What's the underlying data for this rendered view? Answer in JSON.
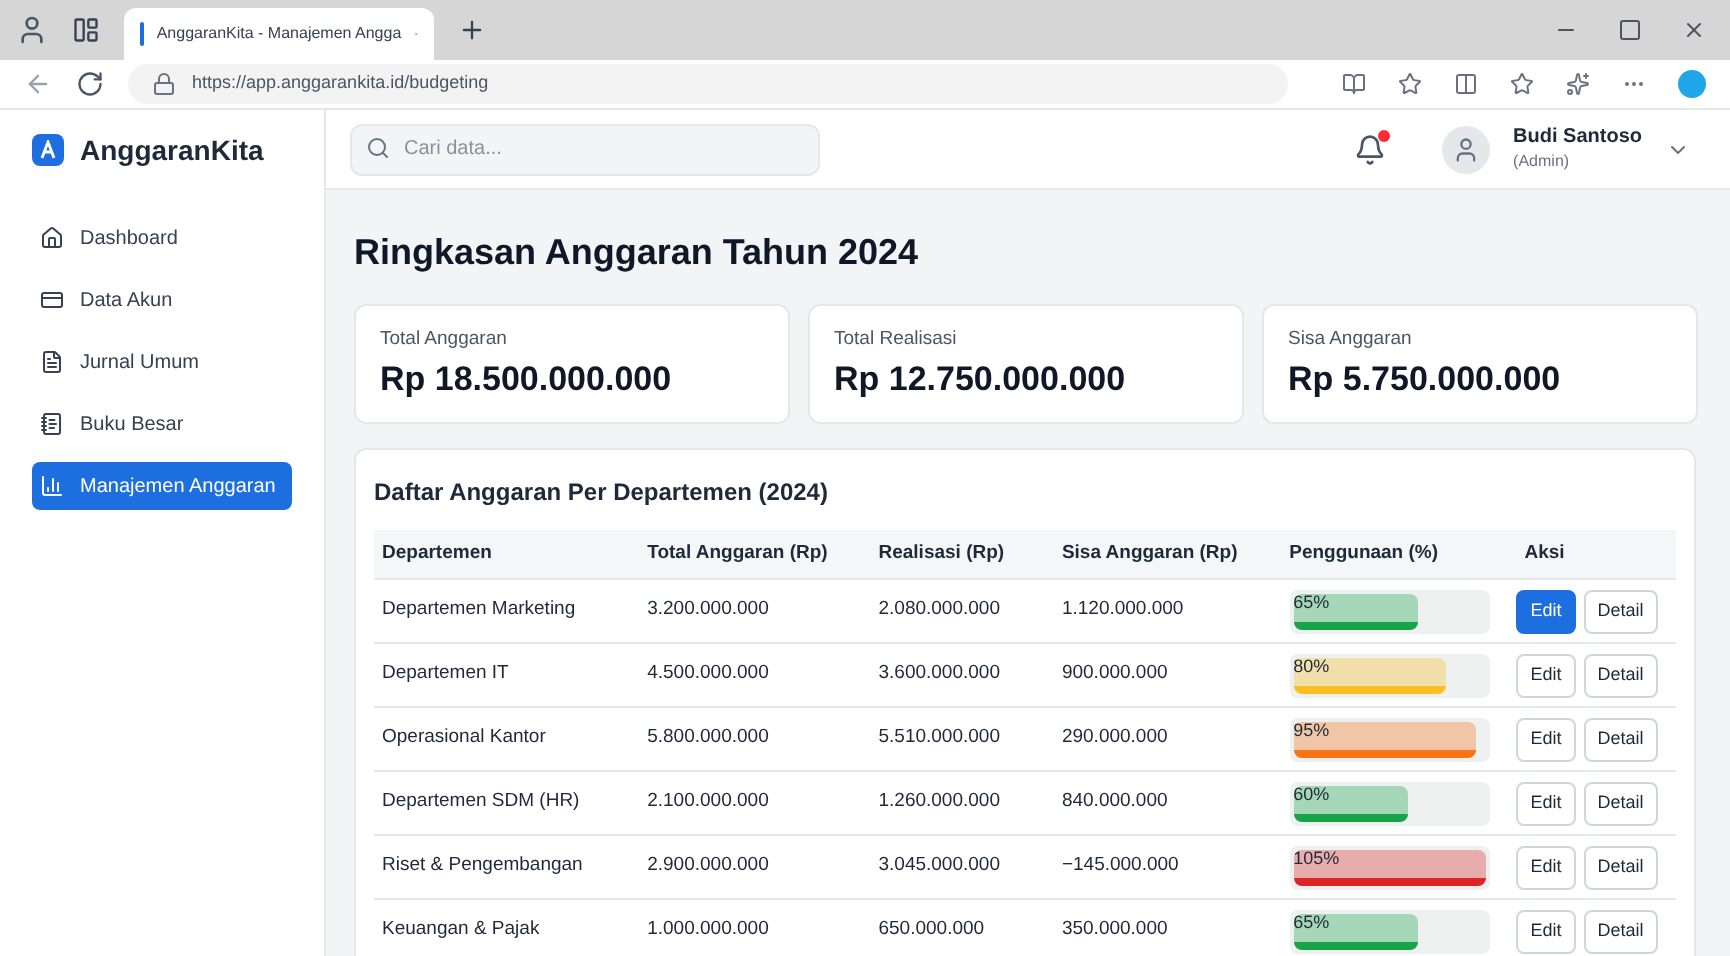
{
  "browser": {
    "tab_title": "AnggaranKita - Manajemen Angga",
    "url": "https://app.anggarankita.id/budgeting"
  },
  "brand": "AnggaranKita",
  "search": {
    "placeholder": "Cari data..."
  },
  "notifications": {
    "unread": true
  },
  "user": {
    "name": "Budi Santoso",
    "role": "(Admin)"
  },
  "sidebar": {
    "items": [
      {
        "kind": "home",
        "label": "Dashboard",
        "selected": false
      },
      {
        "kind": "card",
        "label": "Data Akun",
        "selected": false
      },
      {
        "kind": "file",
        "label": "Jurnal Umum",
        "selected": false
      },
      {
        "kind": "book",
        "label": "Buku Besar",
        "selected": false
      },
      {
        "kind": "chart",
        "label": "Manajemen Anggaran",
        "selected": true
      }
    ]
  },
  "title": "Ringkasan Anggaran Tahun 2024",
  "summary": [
    {
      "label": "Total Anggaran",
      "value": "Rp 18.500.000.000"
    },
    {
      "label": "Total Realisasi",
      "value": "Rp 12.750.000.000"
    },
    {
      "label": "Sisa Anggaran",
      "value": "Rp 5.750.000.000"
    }
  ],
  "table": {
    "title": "Daftar Anggaran Per Departemen (2024)",
    "columns": [
      "Departemen",
      "Total Anggaran (Rp)",
      "Realisasi (Rp)",
      "Sisa Anggaran (Rp)",
      "Penggunaan (%)",
      "Aksi"
    ],
    "rows": [
      {
        "department": "Departemen Marketing",
        "total": "3.200.000.000",
        "realization": "2.080.000.000",
        "remaining": "1.120.000.000",
        "usage": "65%",
        "level": 0.65,
        "color": "#16a34a",
        "edit": "Edit",
        "edit_selected": true,
        "detail": "Detail"
      },
      {
        "department": "Departemen IT",
        "total": "4.500.000.000",
        "realization": "3.600.000.000",
        "remaining": "900.000.000",
        "usage": "80%",
        "level": 0.8,
        "color": "#fbbf24",
        "edit": "Edit",
        "edit_selected": false,
        "detail": "Detail"
      },
      {
        "department": "Operasional Kantor",
        "total": "5.800.000.000",
        "realization": "5.510.000.000",
        "remaining": "290.000.000",
        "usage": "95%",
        "level": 0.95,
        "color": "#f97316",
        "edit": "Edit",
        "edit_selected": false,
        "detail": "Detail"
      },
      {
        "department": "Departemen SDM (HR)",
        "total": "2.100.000.000",
        "realization": "1.260.000.000",
        "remaining": "840.000.000",
        "usage": "60%",
        "level": 0.6,
        "color": "#16a34a",
        "edit": "Edit",
        "edit_selected": false,
        "detail": "Detail"
      },
      {
        "department": "Riset & Pengembangan",
        "total": "2.900.000.000",
        "realization": "3.045.000.000",
        "remaining": "−145.000.000",
        "usage": "105%",
        "level": 1,
        "color": "#dc2626",
        "edit": "Edit",
        "edit_selected": false,
        "detail": "Detail"
      },
      {
        "department": "Keuangan & Pajak",
        "total": "1.000.000.000",
        "realization": "650.000.000",
        "remaining": "350.000.000",
        "usage": "65%",
        "level": 0.65,
        "color": "#16a34a",
        "edit": "Edit",
        "edit_selected": false,
        "detail": "Detail"
      }
    ]
  }
}
